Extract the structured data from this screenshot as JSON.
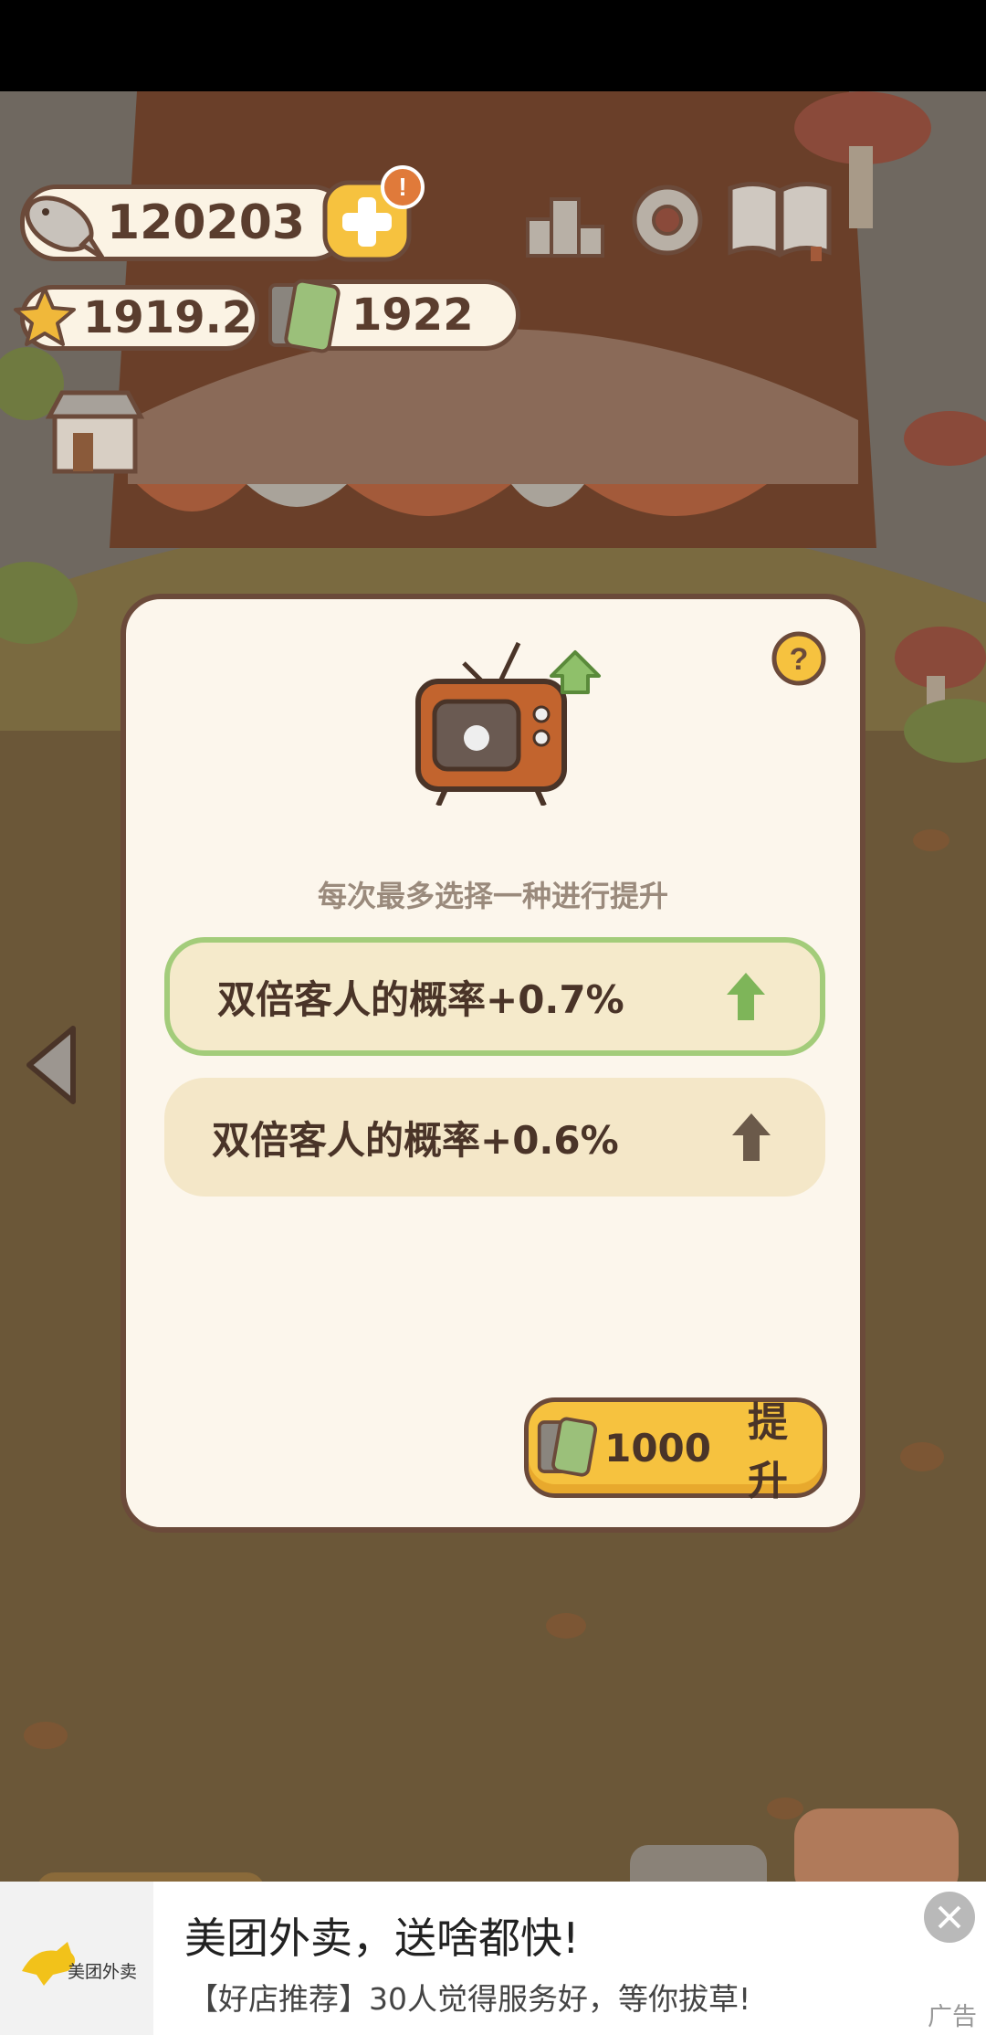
{
  "hud": {
    "fish_count": "120203",
    "star_count": "1919.2",
    "tv_count": "1922",
    "notification_badge": "!",
    "icons": [
      "fish-icon",
      "add-icon",
      "star-icon",
      "tv-ticket-icon",
      "leaderboard-icon",
      "settings-icon",
      "cat-book-icon",
      "shop-icon"
    ]
  },
  "modal": {
    "hint": "每次最多选择一种进行提升",
    "options": [
      {
        "label": "双倍客人的概率+0.7%",
        "selected": true,
        "arrow_color": "#7eb559"
      },
      {
        "label": "双倍客人的概率+0.6%",
        "selected": false,
        "arrow_color": "#6b5a4a"
      }
    ],
    "cost": "1000",
    "upgrade_label": "提升",
    "help": "?"
  },
  "ad": {
    "brand": "美团外卖",
    "title": "美团外卖，送啥都快!",
    "description": "【好店推荐】30人觉得服务好，等你拔草!",
    "tag": "广告"
  },
  "colors": {
    "accent_yellow": "#f6c23f",
    "outline_brown": "#6b4a3a",
    "panel_bg": "#fcf6ec",
    "option_bg": "#f4e7c8",
    "selected_border": "#a3cc7a"
  }
}
